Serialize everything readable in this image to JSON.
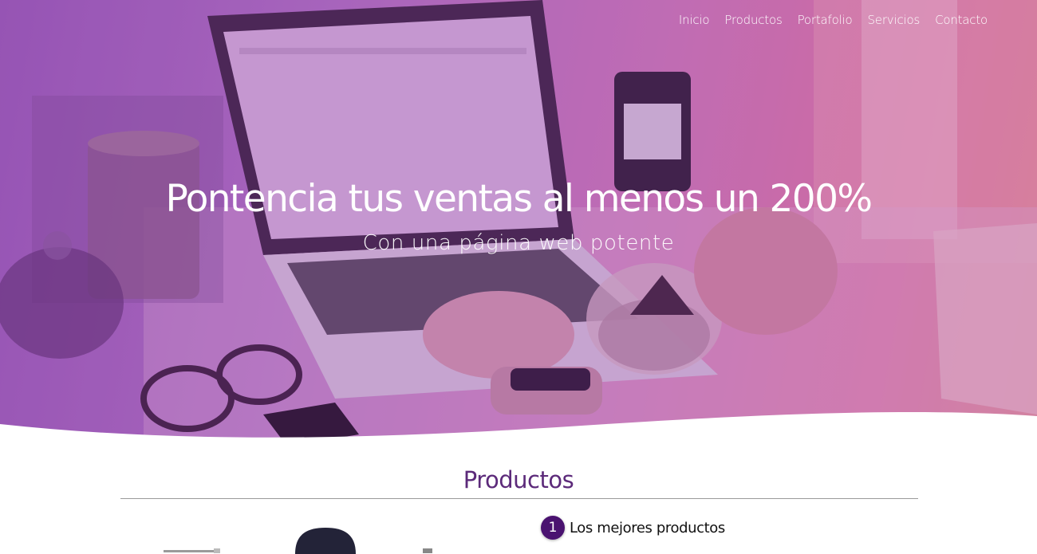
{
  "nav": {
    "items": [
      {
        "label": "Inicio"
      },
      {
        "label": "Productos"
      },
      {
        "label": "Portafolio"
      },
      {
        "label": "Servicios"
      },
      {
        "label": "Contacto"
      }
    ]
  },
  "hero": {
    "title": "Pontencia tus ventas al menos un 200%",
    "subtitle": "Con una página web potente",
    "gradient_colors": [
      "#9a5ab8",
      "#cf79b8",
      "#e8857f"
    ]
  },
  "products_section": {
    "title": "Productos",
    "title_color": "#5c2a7a",
    "features": [
      {
        "number": "1",
        "text": "Los mejores productos"
      }
    ]
  }
}
